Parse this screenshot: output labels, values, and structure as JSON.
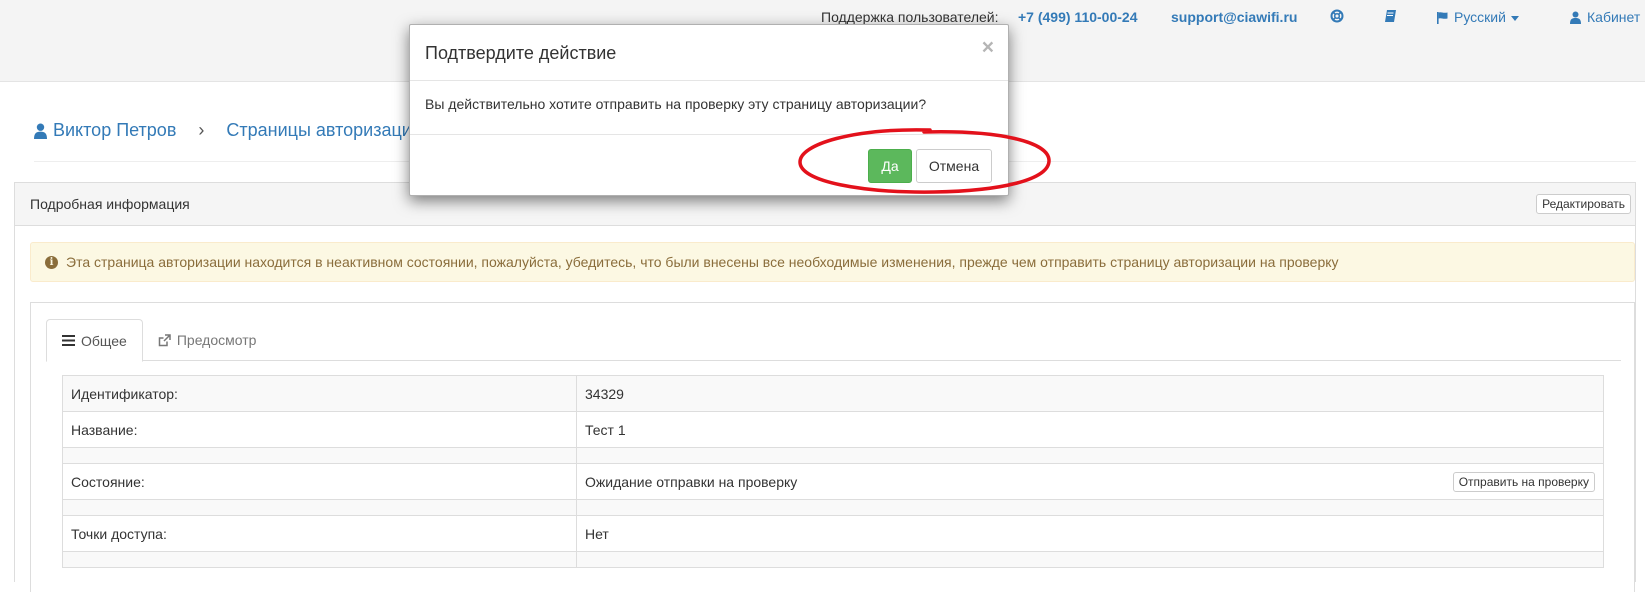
{
  "topbar": {
    "support_label": "Поддержка пользователей:",
    "phone": "+7 (499) 110-00-24",
    "email": "support@ciawifi.ru",
    "help_icon": "lifebuoy-icon",
    "docs_icon": "book-icon",
    "language": "Русский",
    "cabinet": "Кабинет"
  },
  "breadcrumb": {
    "user": "Виктор Петров",
    "separator": "›",
    "section": "Страницы авторизации"
  },
  "panel": {
    "title": "Подробная информация",
    "edit_button": "Редактировать",
    "alert": "Эта страница авторизации находится в неактивном состоянии, пожалуйста, убедитесь, что были внесены все необходимые изменения, прежде чем отправить страницу авторизации на проверку",
    "tabs": [
      {
        "label": "Общее",
        "icon": "list-icon",
        "active": true
      },
      {
        "label": "Предосмотр",
        "icon": "external-link-icon",
        "active": false
      }
    ],
    "fields": {
      "id_label": "Идентификатор:",
      "id_value": "34329",
      "name_label": "Название:",
      "name_value": "Тест 1",
      "state_label": "Состояние:",
      "state_value": "Ожидание отправки на проверку",
      "submit_button": "Отправить на проверку",
      "ap_label": "Точки доступа:",
      "ap_value": "Нет"
    }
  },
  "modal": {
    "title": "Подтвердите действие",
    "close": "×",
    "body": "Вы действительно хотите отправить на проверку эту страницу авторизации?",
    "yes_label": "Да",
    "cancel_label": "Отмена"
  },
  "colors": {
    "link": "#337ab7",
    "success": "#5cb85c",
    "alert_bg": "#fcf8e3",
    "alert_text": "#8a6d3b",
    "annotation": "#e3111b"
  }
}
